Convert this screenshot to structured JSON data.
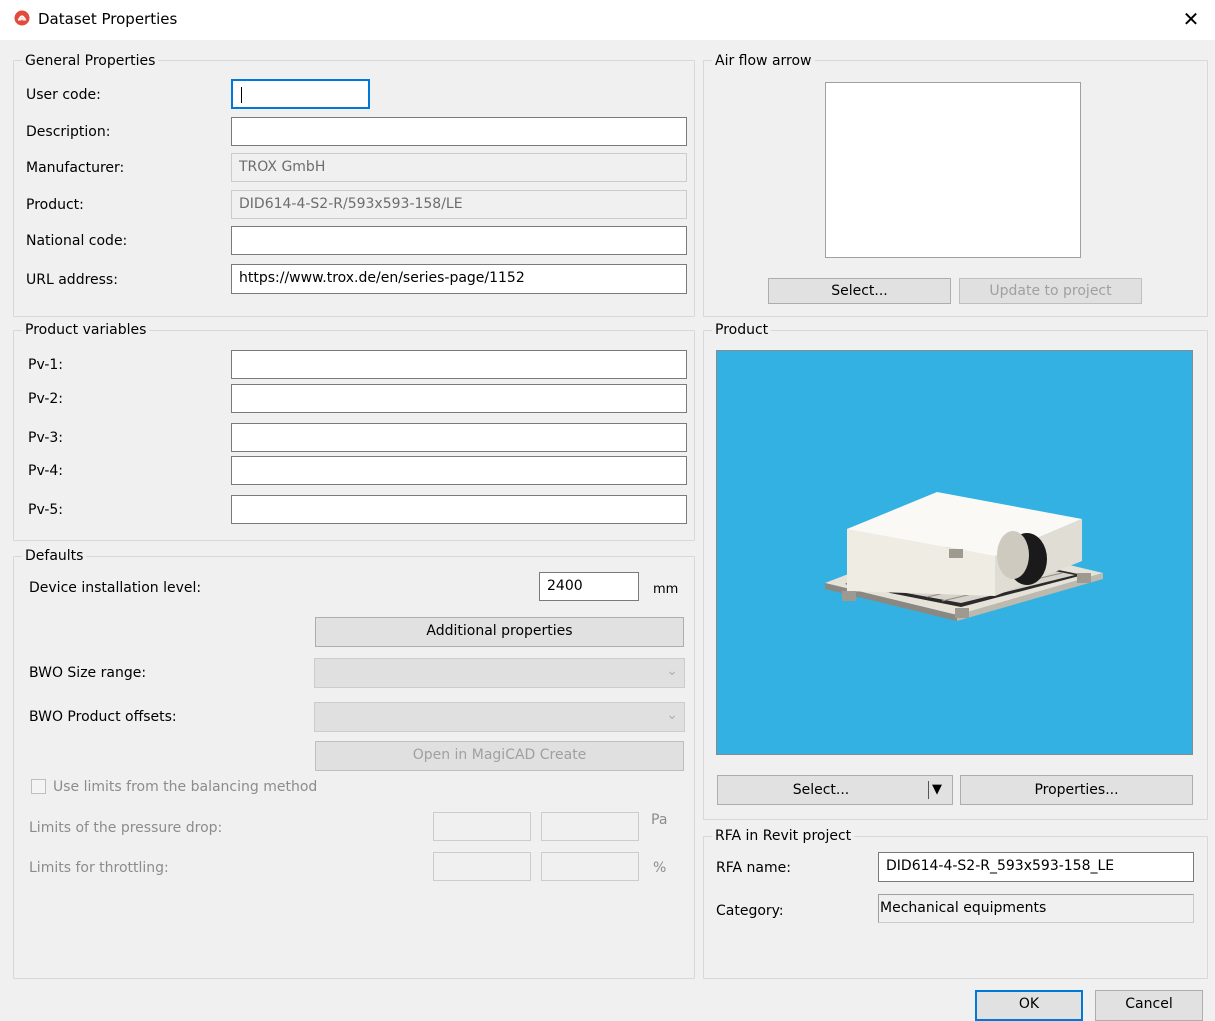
{
  "window": {
    "title": "Dataset Properties",
    "close_glyph": "✕"
  },
  "general": {
    "legend": "General Properties",
    "user_code": {
      "label": "User code:",
      "value": ""
    },
    "description": {
      "label": "Description:",
      "value": ""
    },
    "manufacturer": {
      "label": "Manufacturer:",
      "value": "TROX GmbH"
    },
    "product": {
      "label": "Product:",
      "value": "DID614-4-S2-R/593x593-158/LE"
    },
    "national_code": {
      "label": "National code:",
      "value": ""
    },
    "url": {
      "label": "URL address:",
      "value": "https://www.trox.de/en/series-page/1152"
    }
  },
  "variables": {
    "legend": "Product variables",
    "items": [
      {
        "label": "Pv-1:",
        "value": ""
      },
      {
        "label": "Pv-2:",
        "value": ""
      },
      {
        "label": "Pv-3:",
        "value": ""
      },
      {
        "label": "Pv-4:",
        "value": ""
      },
      {
        "label": "Pv-5:",
        "value": ""
      }
    ]
  },
  "defaults": {
    "legend": "Defaults",
    "install_level_label": "Device installation level:",
    "install_level_value": "2400",
    "install_level_unit": "mm",
    "additional_button": "Additional properties",
    "bwo_size_label": "BWO Size range:",
    "bwo_offsets_label": "BWO Product offsets:",
    "open_magicad_button": "Open in MagiCAD Create",
    "use_limits_label": "Use limits from the balancing method",
    "pressure_drop_label": "Limits of the pressure drop:",
    "pressure_unit": "Pa",
    "throttling_label": "Limits for throttling:",
    "throttling_unit": "%"
  },
  "airflow": {
    "legend": "Air flow arrow",
    "select_button": "Select...",
    "update_button": "Update to project"
  },
  "product_panel": {
    "legend": "Product",
    "select_button": "Select...",
    "properties_button": "Properties...",
    "preview_bg": "#33b1e3"
  },
  "rfa": {
    "legend": "RFA in Revit project",
    "name_label": "RFA name:",
    "name_value": "DID614-4-S2-R_593x593-158_LE",
    "category_label": "Category:",
    "category_value": "Mechanical equipments"
  },
  "footer": {
    "ok": "OK",
    "cancel": "Cancel"
  },
  "colors": {
    "accent": "#0078d7",
    "app_icon": "#e24a3b"
  }
}
